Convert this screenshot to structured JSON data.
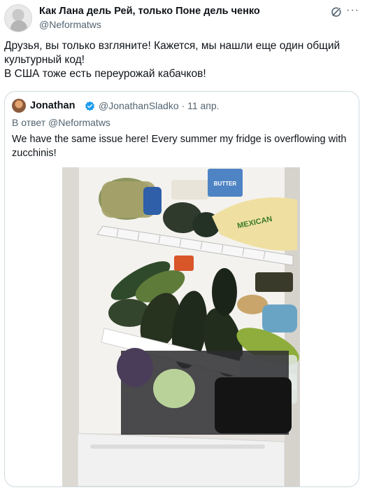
{
  "post": {
    "author_name": "Как Лана дель Рей, только Поне дель ченко",
    "author_handle": "@Neformatws",
    "text_lines": [
      "Друзья, вы только взгляните! Кажется, мы нашли еще один общий культурный код!",
      "В США тоже есть переурожай кабачков!"
    ]
  },
  "quote": {
    "name": "Jonathan",
    "handle": "@JonathanSladko",
    "separator": "·",
    "date": "11 апр.",
    "reply_prefix": "В ответ",
    "reply_mention": "@Neformatws",
    "text": "We have the same issue here! Every summer my fridge is overflowing with zucchinis!",
    "photo_labels": {
      "bag_text": "MEXICAN",
      "box_text": "BUTTER"
    }
  },
  "icons": {
    "grok": "grok-icon",
    "more": "more-dots-icon",
    "verified": "verified-badge-icon"
  },
  "colors": {
    "verified": "#1d9bf0",
    "secondary_text": "#536471",
    "border": "#cfd9de"
  }
}
